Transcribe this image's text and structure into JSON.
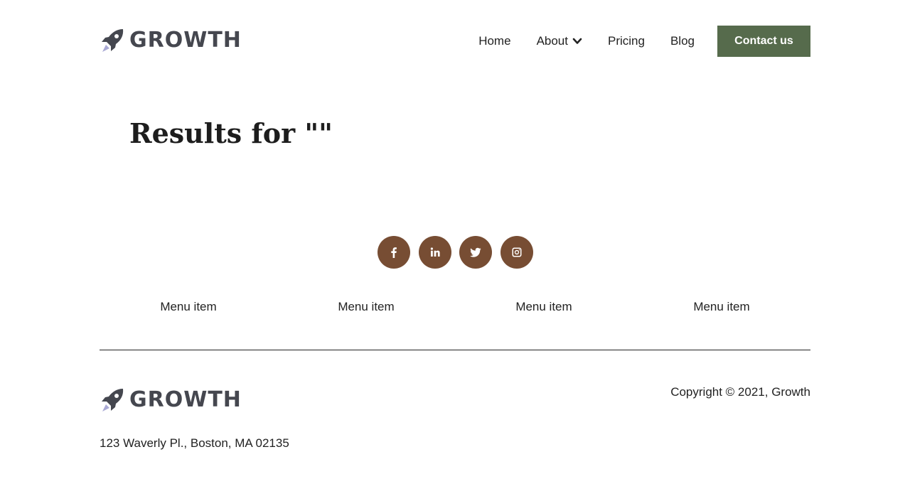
{
  "brand": {
    "name": "GROWTH",
    "logo_color": "#45474f",
    "accent_color": "#a9a9d4"
  },
  "nav": {
    "items": [
      {
        "label": "Home"
      },
      {
        "label": "About",
        "has_dropdown": true,
        "icon": "chevron-down-icon"
      },
      {
        "label": "Pricing"
      },
      {
        "label": "Blog"
      }
    ],
    "cta_label": "Contact us",
    "cta_color": "#566b4c"
  },
  "main": {
    "title": "Results for \"\""
  },
  "social": {
    "color": "#774d33",
    "items": [
      {
        "icon": "facebook-icon"
      },
      {
        "icon": "linkedin-icon"
      },
      {
        "icon": "twitter-icon"
      },
      {
        "icon": "instagram-icon"
      }
    ]
  },
  "footer": {
    "menu": [
      "Menu item",
      "Menu item",
      "Menu item",
      "Menu item"
    ],
    "copyright": "Copyright © 2021, Growth",
    "address": "123 Waverly Pl., Boston, MA 02135"
  }
}
